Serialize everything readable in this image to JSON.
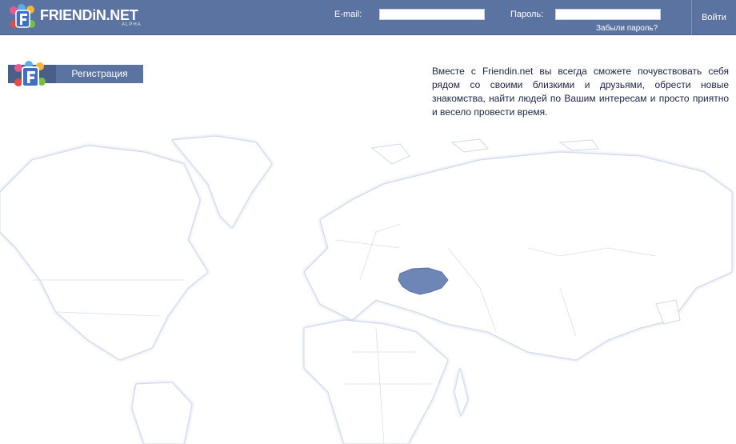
{
  "header": {
    "logo_text": "FRIENDiN.NET",
    "logo_sub": "ALPHA",
    "email_label": "E-mail:",
    "email_value": "",
    "password_label": "Пароль:",
    "password_value": "",
    "forgot_link": "Забыли пароль?",
    "login_button": "Войти"
  },
  "registration": {
    "label": "Регистрация"
  },
  "intro_text": "Вместе с Friendin.net вы всегда сможете почувствовать себя рядом со своими близкими и друзьями, обрести новые знакомства, найти людей по Вашим интересам и просто приятно и весело провести время.",
  "map": {
    "highlighted_country": "Ukraine",
    "colors": {
      "land": "#ffffff",
      "land_edge": "#bcc9df",
      "border": "#d3dceb",
      "highlight": "#6d86b6"
    }
  },
  "colors": {
    "bar": "#5b73a0",
    "text": "#1a2444"
  }
}
